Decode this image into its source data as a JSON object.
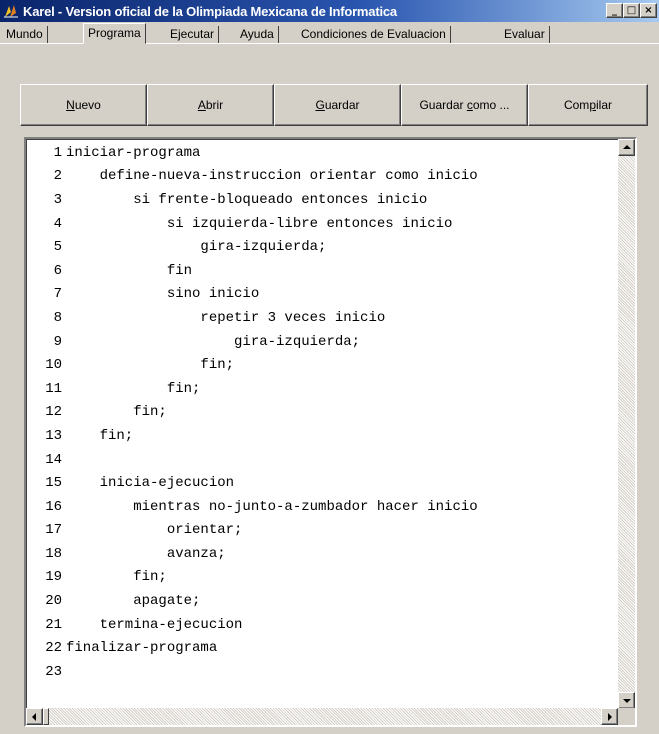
{
  "window": {
    "title": "Karel - Version oficial de la Olimpiada Mexicana de Informatica",
    "icon": "karel-app-icon",
    "minimize": "_",
    "maximize": "□",
    "close": "×"
  },
  "tabs": [
    {
      "label": "Mundo",
      "active": false
    },
    {
      "label": "Programa",
      "active": true
    },
    {
      "label": "Ejecutar",
      "active": false
    },
    {
      "label": "Ayuda",
      "active": false
    },
    {
      "label": "Condiciones de Evaluacion",
      "active": false
    },
    {
      "label": "Evaluar",
      "active": false
    }
  ],
  "toolbar": {
    "nuevo": {
      "accel": "N",
      "rest": "uevo"
    },
    "abrir": {
      "accel": "A",
      "rest": "brir"
    },
    "guardar": {
      "accel": "G",
      "rest": "uardar"
    },
    "guardar_como": {
      "before": "Guardar ",
      "accel": "c",
      "rest": "omo ..."
    },
    "compilar": {
      "before": "Com",
      "accel": "p",
      "rest": "ilar"
    }
  },
  "editor": {
    "lines": [
      {
        "n": "1",
        "text": "iniciar-programa"
      },
      {
        "n": "2",
        "text": "    define-nueva-instruccion orientar como inicio"
      },
      {
        "n": "3",
        "text": "        si frente-bloqueado entonces inicio"
      },
      {
        "n": "4",
        "text": "            si izquierda-libre entonces inicio"
      },
      {
        "n": "5",
        "text": "                gira-izquierda;"
      },
      {
        "n": "6",
        "text": "            fin"
      },
      {
        "n": "7",
        "text": "            sino inicio"
      },
      {
        "n": "8",
        "text": "                repetir 3 veces inicio"
      },
      {
        "n": "9",
        "text": "                    gira-izquierda;"
      },
      {
        "n": "10",
        "text": "                fin;"
      },
      {
        "n": "11",
        "text": "            fin;"
      },
      {
        "n": "12",
        "text": "        fin;"
      },
      {
        "n": "13",
        "text": "    fin;"
      },
      {
        "n": "14",
        "text": ""
      },
      {
        "n": "15",
        "text": "    inicia-ejecucion"
      },
      {
        "n": "16",
        "text": "        mientras no-junto-a-zumbador hacer inicio"
      },
      {
        "n": "17",
        "text": "            orientar;"
      },
      {
        "n": "18",
        "text": "            avanza;"
      },
      {
        "n": "19",
        "text": "        fin;"
      },
      {
        "n": "20",
        "text": "        apagate;"
      },
      {
        "n": "21",
        "text": "    termina-ejecucion"
      },
      {
        "n": "22",
        "text": "finalizar-programa"
      },
      {
        "n": "23",
        "text": ""
      }
    ]
  }
}
